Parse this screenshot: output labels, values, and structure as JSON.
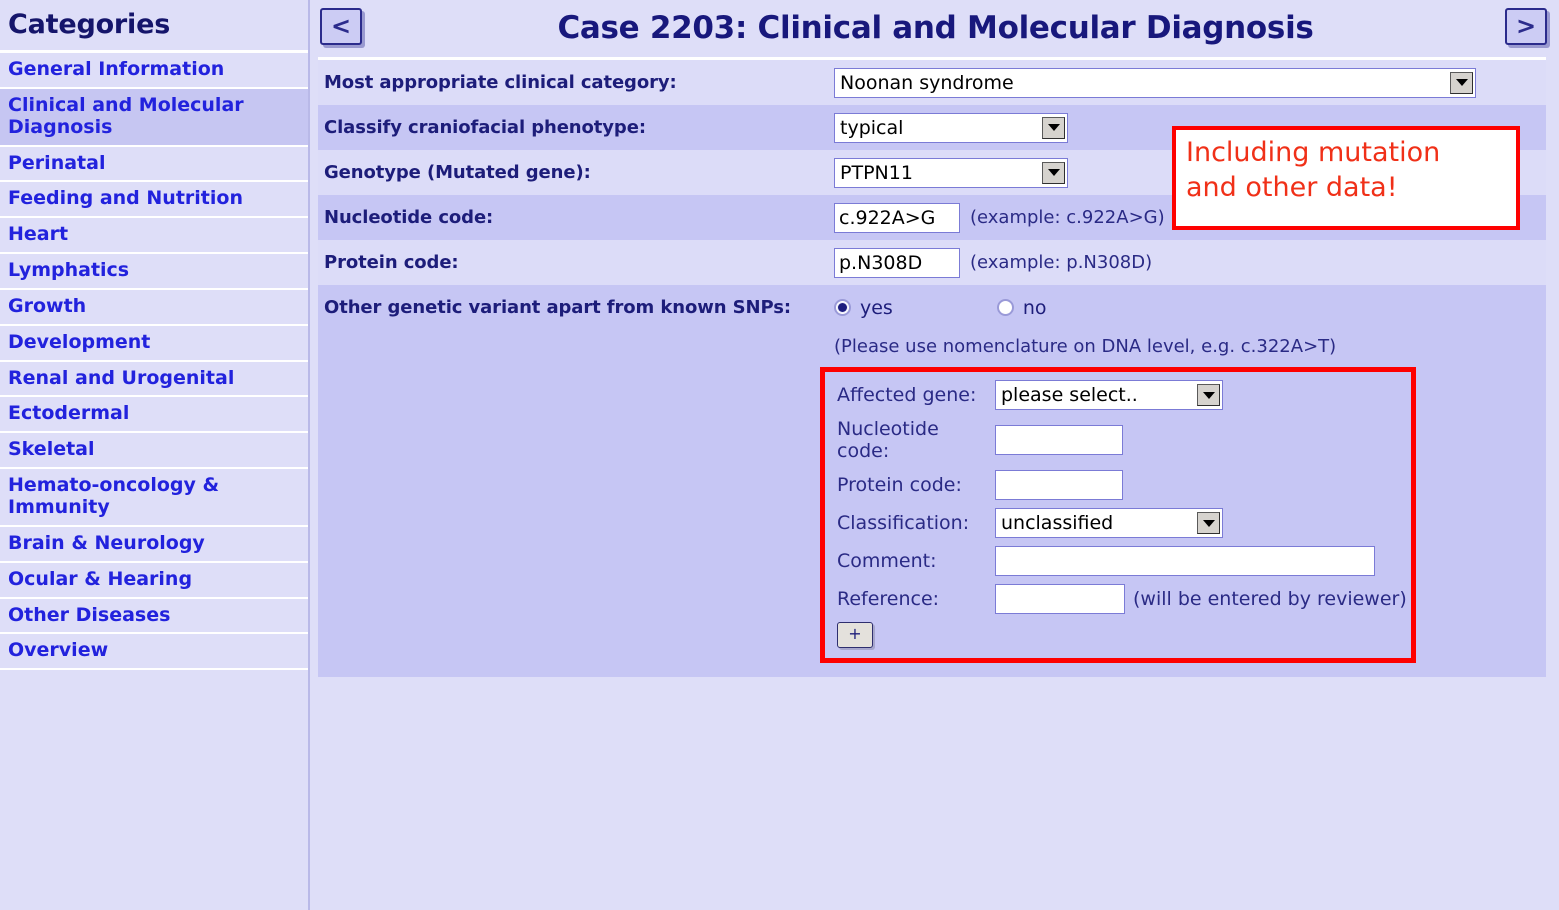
{
  "sidebar": {
    "header": "Categories",
    "items": [
      {
        "label": "General Information",
        "selected": false
      },
      {
        "label": "Clinical and Molecular Diagnosis",
        "selected": true
      },
      {
        "label": "Perinatal",
        "selected": false
      },
      {
        "label": "Feeding and Nutrition",
        "selected": false
      },
      {
        "label": "Heart",
        "selected": false
      },
      {
        "label": "Lymphatics",
        "selected": false
      },
      {
        "label": "Growth",
        "selected": false
      },
      {
        "label": "Development",
        "selected": false
      },
      {
        "label": "Renal and Urogenital",
        "selected": false
      },
      {
        "label": "Ectodermal",
        "selected": false
      },
      {
        "label": "Skeletal",
        "selected": false
      },
      {
        "label": "Hemato-oncology & Immunity",
        "selected": false
      },
      {
        "label": "Brain & Neurology",
        "selected": false
      },
      {
        "label": "Ocular & Hearing",
        "selected": false
      },
      {
        "label": "Other Diseases",
        "selected": false
      },
      {
        "label": "Overview",
        "selected": false
      }
    ]
  },
  "header": {
    "title": "Case 2203: Clinical and Molecular Diagnosis",
    "prev_label": "<",
    "next_label": ">"
  },
  "form": {
    "clinical_category": {
      "label": "Most appropriate clinical category:",
      "value": "Noonan syndrome"
    },
    "craniofacial": {
      "label": "Classify craniofacial phenotype:",
      "value": "typical"
    },
    "genotype": {
      "label": "Genotype (Mutated gene):",
      "value": "PTPN11"
    },
    "nucleotide": {
      "label": "Nucleotide code:",
      "value": "c.922A>G",
      "example": "(example: c.922A>G)"
    },
    "protein": {
      "label": "Protein code:",
      "value": "p.N308D",
      "example": "(example: p.N308D)"
    },
    "other_variant": {
      "label": "Other genetic variant apart from known SNPs:",
      "yes_label": "yes",
      "no_label": "no",
      "selected": "yes"
    },
    "nomenclature_note": "(Please use nomenclature on DNA level, e.g. c.322A>T)"
  },
  "variant": {
    "affected_gene": {
      "label": "Affected gene:",
      "value": "please select.."
    },
    "nucleotide_code": {
      "label": "Nucleotide code:",
      "value": ""
    },
    "protein_code": {
      "label": "Protein code:",
      "value": ""
    },
    "classification": {
      "label": "Classification:",
      "value": "unclassified"
    },
    "comment": {
      "label": "Comment:",
      "value": ""
    },
    "reference": {
      "label": "Reference:",
      "value": "",
      "note": "(will be entered by reviewer)"
    },
    "add_label": "+"
  },
  "callout": {
    "line1": "Including mutation",
    "line2": "and other data!"
  },
  "colors": {
    "annotation_red": "#fe0000",
    "callout_text": "#f03018",
    "link_blue": "#2222dd",
    "label_navy": "#1d1d7a",
    "row_light": "#dcdcf8",
    "row_dark": "#c6c6f4",
    "page_bg": "#dedef8"
  }
}
